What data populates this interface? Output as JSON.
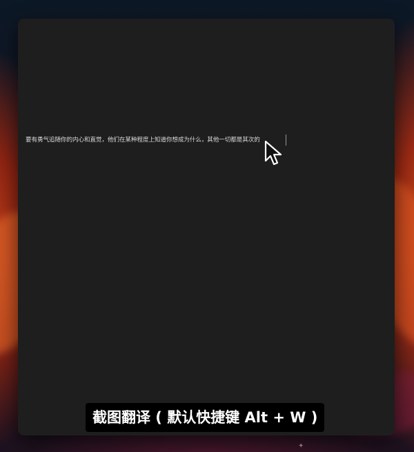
{
  "screen": {
    "selected_text": "要有勇气追随你的内心和直觉，他们在某种程度上知道你想成为什么，其他一切都是其次的",
    "caption": "截图翻译 ( 默认快捷键 Alt + W )"
  },
  "icons": {
    "cursor": "arrow-pointer-icon",
    "sparkle": "sparkle-icon"
  },
  "colors": {
    "window_bg": "#1e1e1e",
    "caption_bg": "#000000",
    "text": "#d8d8d8"
  }
}
